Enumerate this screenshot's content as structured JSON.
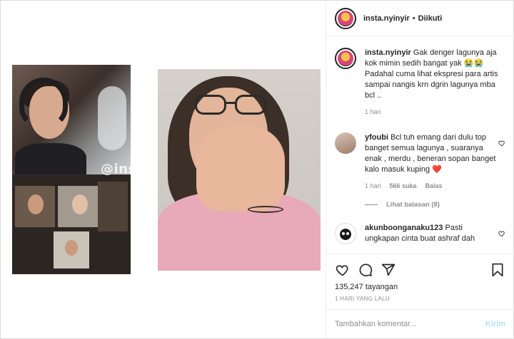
{
  "header": {
    "username": "insta.nyinyir",
    "separator": "•",
    "follow_status": "Diikuti"
  },
  "media": {
    "watermark": "@insta.nyinyir"
  },
  "caption": {
    "username": "insta.nyinyir",
    "text": "Gak denger lagunya aja kok mimin sedih bangat yak 😭😭 Padahal cuma lihat ekspresi para artis sampai nangis krn dgrin lagunya mba bcl ..",
    "time": "1 hari"
  },
  "comments": [
    {
      "username": "yfoubi",
      "text": "Bcl tuh emang dari dulu top banget semua lagunya , suaranya enak , merdu , beneran sopan banget kalo masuk kuping ❤️",
      "time": "1 hari",
      "likes": "566 suka",
      "reply_label": "Balas",
      "view_replies": "Lihat balasan (8)"
    },
    {
      "username": "akunboonganaku123",
      "text": "Pasti ungkapan cinta buat ashraf dah"
    }
  ],
  "stats": {
    "views": "135,247 tayangan",
    "posted": "1 HARI YANG LALU"
  },
  "add_comment": {
    "placeholder": "Tambahkan komentar...",
    "post_label": "Kirim"
  },
  "icons": {
    "like": "heart-icon",
    "comment": "comment-icon",
    "share": "share-icon",
    "save": "bookmark-icon"
  },
  "colors": {
    "text": "#262626",
    "muted": "#8e8e8e",
    "border": "#efefef",
    "post_button_disabled": "#b2dffc",
    "heart_red": "#ed4956"
  }
}
